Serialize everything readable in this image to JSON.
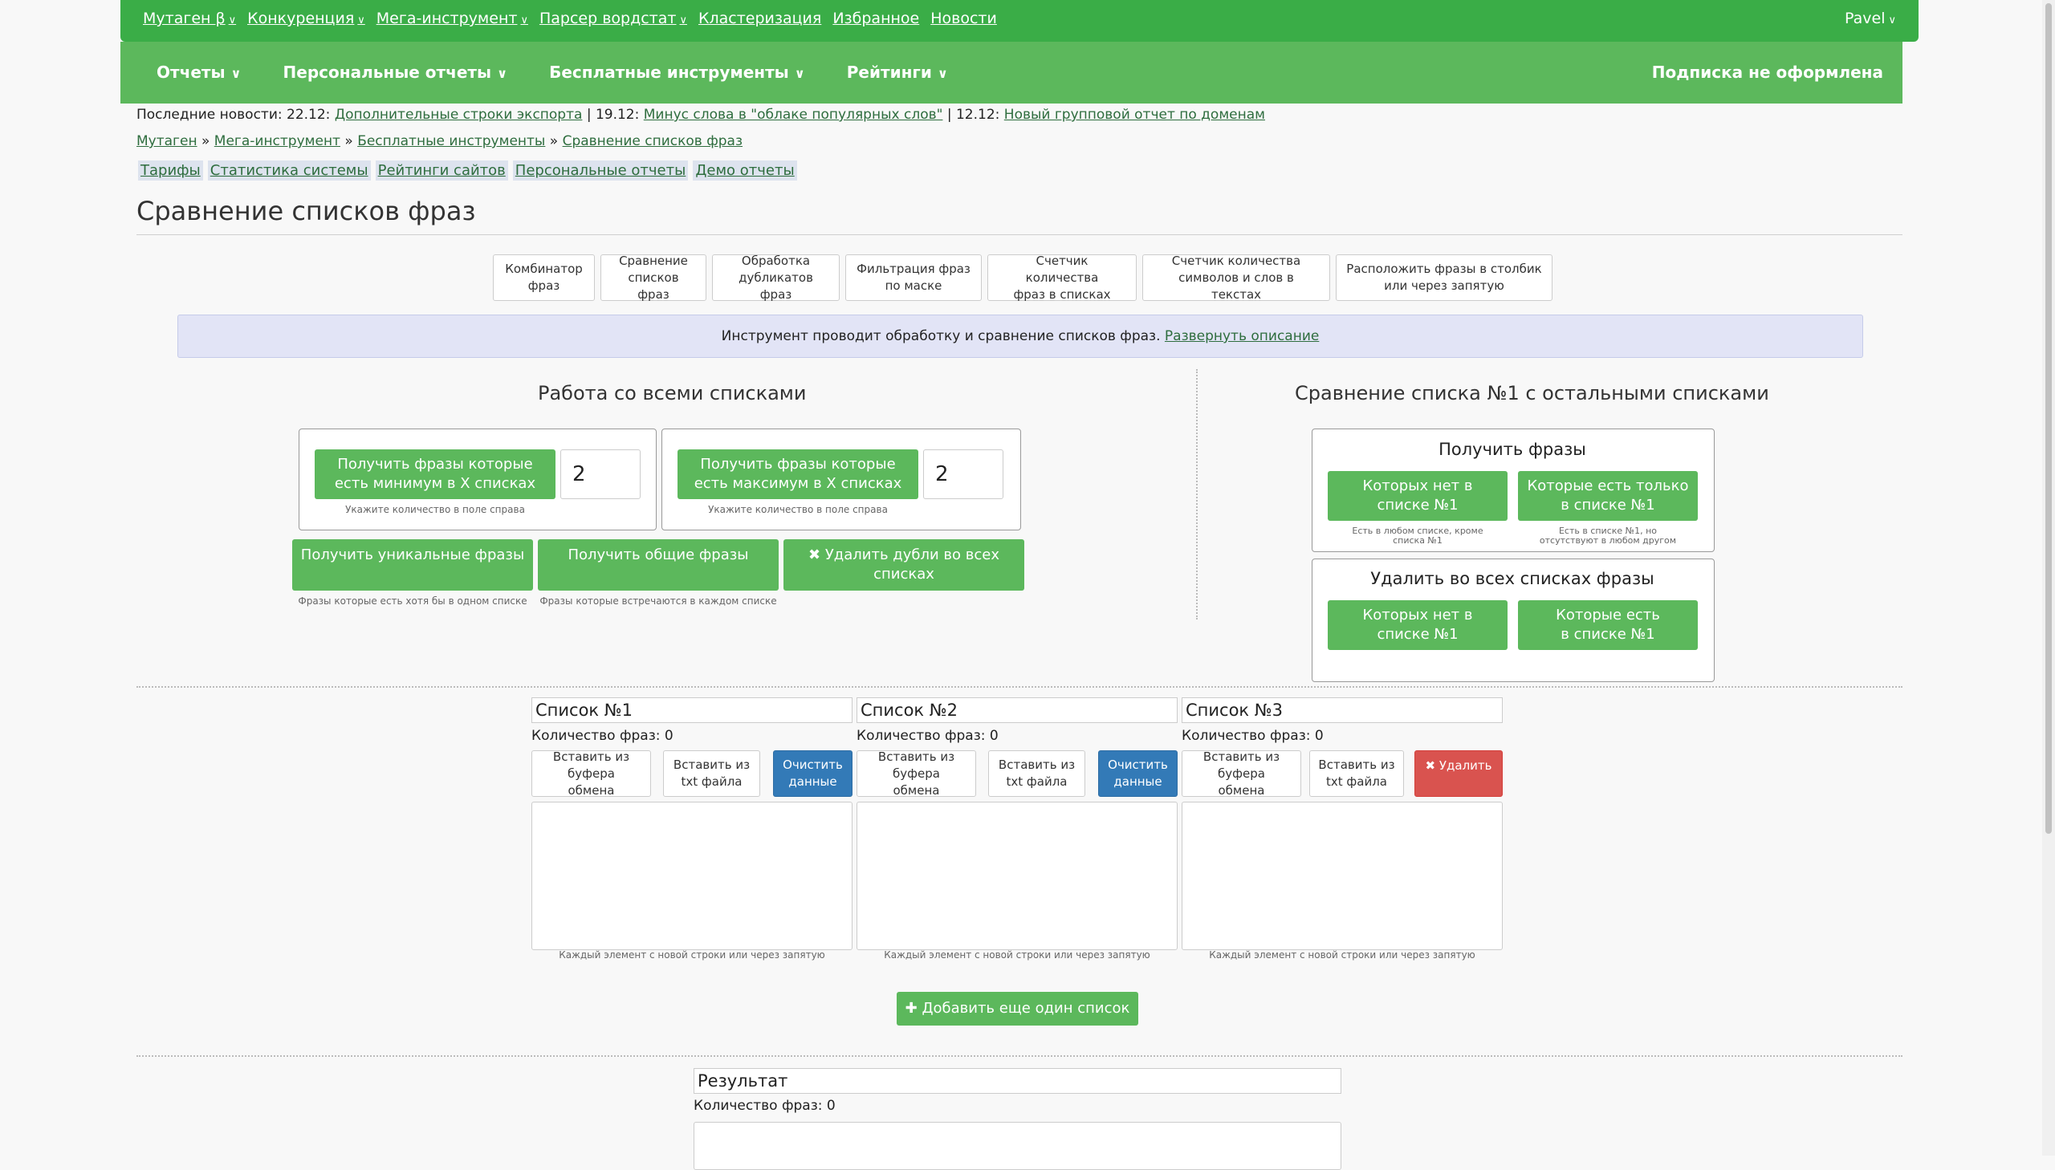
{
  "topnav": {
    "items": [
      "Мутаген β",
      "Конкуренция",
      "Мега-инструмент",
      "Парсер вордстат",
      "Кластеризация",
      "Избранное",
      "Новости"
    ],
    "user": "Pavel"
  },
  "subnav": {
    "items": [
      "Отчеты",
      "Персональные отчеты",
      "Бесплатные инструменты",
      "Рейтинги"
    ],
    "right": "Подписка не оформлена"
  },
  "news": {
    "prefix": "Последние новости: 22.12:",
    "link1": "Дополнительные строки экспорта",
    "sep1": "| 19.12:",
    "link2": "Минус слова в \"облаке популярных слов\"",
    "sep2": "| 12.12:",
    "link3": "Новый групповой отчет по доменам"
  },
  "breadcrumb": [
    "Мутаген",
    "Мега-инструмент",
    "Бесплатные инструменты",
    "Сравнение списков фраз"
  ],
  "quicklinks": [
    "Тарифы",
    "Статистика системы",
    "Рейтинги сайтов",
    "Персональные отчеты",
    "Демо отчеты"
  ],
  "page_title": "Сравнение списков фраз",
  "tools": [
    {
      "l1": "Комбинатор",
      "l2": "фраз"
    },
    {
      "l1": "Сравнение",
      "l2": "списков фраз"
    },
    {
      "l1": "Обработка",
      "l2": "дубликатов фраз"
    },
    {
      "l1": "Фильтрация фраз",
      "l2": "по маске"
    },
    {
      "l1": "Счетчик количества",
      "l2": "фраз в списках"
    },
    {
      "l1": "Счетчик количества",
      "l2": "символов и слов в текстах"
    },
    {
      "l1": "Расположить фразы в столбик",
      "l2": "или через запятую"
    }
  ],
  "info": {
    "text": "Инструмент проводит обработку и сравнение списков фраз.",
    "link": "Развернуть описание"
  },
  "left": {
    "title": "Работа со всеми списками",
    "min_btn": "Получить фразы которые есть минимум в X списках",
    "min_value": "2",
    "max_btn": "Получить фразы которые есть максимум в X списках",
    "max_value": "2",
    "field_hint": "Укажите количество в поле справа",
    "unique_btn": "Получить уникальные фразы",
    "unique_hint": "Фразы которые есть хотя бы в одном списке",
    "common_btn": "Получить общие фразы",
    "common_hint": "Фразы которые встречаются в каждом списке",
    "dedupe_btn": "Удалить дубли во всех списках"
  },
  "right": {
    "title": "Сравнение списка №1 с остальными списками",
    "get_title": "Получить фразы",
    "get_btn1": "Которых нет в списке №1",
    "get_hint1": "Есть в любом списке, кроме списка №1",
    "get_btn2": "Которые есть только в списке №1",
    "get_hint2": "Есть в списке №1, но отсутствуют в любом другом",
    "del_title": "Удалить во всех списках фразы",
    "del_btn1": "Которых нет в списке №1",
    "del_btn2": "Которые есть в списке №1"
  },
  "lists": [
    {
      "name": "Список №1",
      "count": "Количество фраз: 0",
      "paste": "Вставить из буфера обмена",
      "txt": "Вставить из txt файла",
      "action": "Очистить данные"
    },
    {
      "name": "Список №2",
      "count": "Количество фраз: 0",
      "paste": "Вставить из буфера обмена",
      "txt": "Вставить из txt файла",
      "action": "Очистить данные"
    },
    {
      "name": "Список №3",
      "count": "Количество фраз: 0",
      "paste": "Вставить из буфера обмена",
      "txt": "Вставить из txt файла",
      "action": "Удалить"
    }
  ],
  "list_hint": "Каждый элемент с новой строки или через запятую",
  "add_list_btn": "Добавить еще один список",
  "result": {
    "name": "Результат",
    "count": "Количество фраз: 0"
  },
  "colors": {
    "nav_green": "#3aad47",
    "sub_green": "#5cb85c",
    "blue": "#337ab7",
    "red": "#d9534f"
  }
}
